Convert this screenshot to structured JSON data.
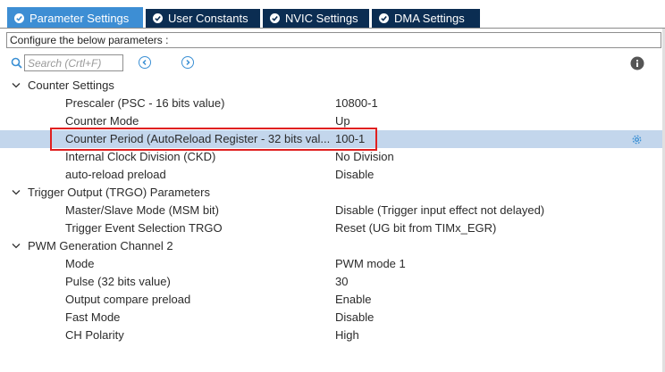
{
  "tabs": [
    {
      "label": "Parameter Settings",
      "active": true
    },
    {
      "label": "User Constants",
      "active": false
    },
    {
      "label": "NVIC Settings",
      "active": false
    },
    {
      "label": "DMA Settings",
      "active": false
    }
  ],
  "configure_label": "Configure the below parameters :",
  "search": {
    "placeholder": "Search (Crtl+F)"
  },
  "groups": [
    {
      "name": "Counter Settings",
      "params": [
        {
          "name": "Prescaler (PSC - 16 bits value)",
          "value": "10800-1"
        },
        {
          "name": "Counter Mode",
          "value": "Up"
        },
        {
          "name": "Counter Period (AutoReload Register - 32 bits val...",
          "value": "100-1",
          "selected": true
        },
        {
          "name": "Internal Clock Division (CKD)",
          "value": "No Division"
        },
        {
          "name": "auto-reload preload",
          "value": "Disable"
        }
      ]
    },
    {
      "name": "Trigger Output (TRGO) Parameters",
      "params": [
        {
          "name": "Master/Slave Mode (MSM bit)",
          "value": "Disable (Trigger input effect not delayed)"
        },
        {
          "name": "Trigger Event Selection TRGO",
          "value": "Reset (UG bit from TIMx_EGR)"
        }
      ]
    },
    {
      "name": "PWM Generation Channel 2",
      "params": [
        {
          "name": "Mode",
          "value": "PWM mode 1"
        },
        {
          "name": "Pulse (32 bits value)",
          "value": "30"
        },
        {
          "name": "Output compare preload",
          "value": "Enable"
        },
        {
          "name": "Fast Mode",
          "value": "Disable"
        },
        {
          "name": "CH Polarity",
          "value": "High"
        }
      ]
    }
  ],
  "colors": {
    "tab_bg": "#0b2d52",
    "tab_active_bg": "#3d8ed4",
    "selection_bg": "#c3d6ec",
    "highlight_border": "#e02020"
  }
}
